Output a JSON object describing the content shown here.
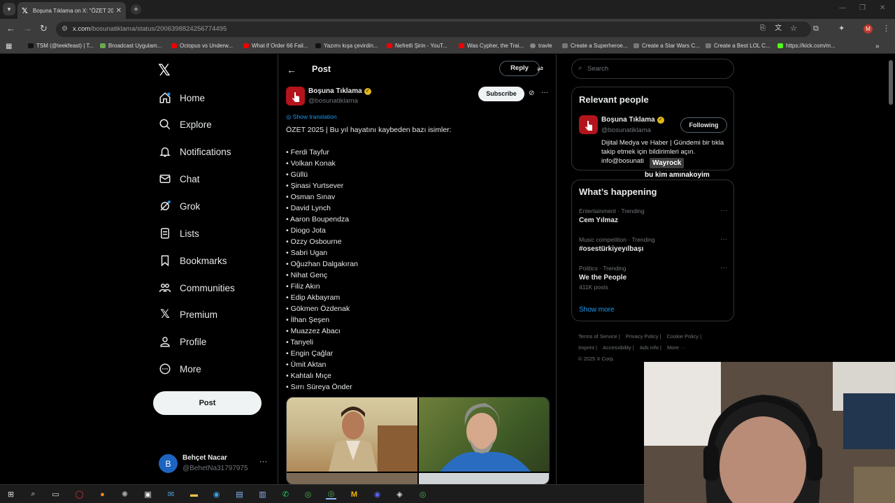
{
  "browser": {
    "tab_title": "Boşuna Tıklama on X: \"ÖZET 20…",
    "url_host": "x.com",
    "url_path": "/bosunatiklama/status/2006398824256774495",
    "profile_initial": "M",
    "bookmarks": [
      "TSM (@teekfeast) | T...",
      "Broadcast Uygulam...",
      "Octopus vs Underw...",
      "What if Order 66 Fail...",
      "Yazımı kışa çevirdin...",
      "Nefretli Şirin - YouT...",
      "Was Cypher, the Trai...",
      "travle",
      "Create a Superheroe...",
      "Create a Star Wars C...",
      "Create a Best LOL C...",
      "https://kick.com/m..."
    ]
  },
  "nav": {
    "items": [
      {
        "label": "Home",
        "icon": "home-icon"
      },
      {
        "label": "Explore",
        "icon": "search-icon"
      },
      {
        "label": "Notifications",
        "icon": "bell-icon"
      },
      {
        "label": "Chat",
        "icon": "mail-icon"
      },
      {
        "label": "Grok",
        "icon": "grok-icon"
      },
      {
        "label": "Lists",
        "icon": "list-icon"
      },
      {
        "label": "Bookmarks",
        "icon": "bookmark-icon"
      },
      {
        "label": "Communities",
        "icon": "people-icon"
      },
      {
        "label": "Premium",
        "icon": "x-icon"
      },
      {
        "label": "Profile",
        "icon": "person-icon"
      },
      {
        "label": "More",
        "icon": "more-circle-icon"
      }
    ],
    "post_button": "Post",
    "account": {
      "initial": "B",
      "name": "Behçet Nacar",
      "handle": "@BehetNa31797975"
    }
  },
  "post": {
    "header_title": "Post",
    "reply_button": "Reply",
    "author_name": "Boşuna Tıklama",
    "author_handle": "@bosunatiklama",
    "subscribe_button": "Subscribe",
    "show_translation": "Show translation",
    "intro": "ÖZET 2025 | Bu yıl hayatını kaybeden bazı isimler:",
    "names": [
      "• Ferdi Tayfur",
      "• Volkan Konak",
      "• Güllü",
      "• Şinasi Yurtsever",
      "• Osman Sınav",
      "• David Lynch",
      "• Aaron Boupendza",
      "• Diogo Jota",
      "• Ozzy Osbourne",
      "• Sabri Ugan",
      "• Oğuzhan Dalgakıran",
      "• Nihat Genç",
      "• Filiz Akın",
      "• Edip Akbayram",
      "• Gökmen Özdenak",
      "• İlhan Şeşen",
      "• Muazzez Abacı",
      "• Tanyeli",
      "• Engin Çağlar",
      "• Ümit Aktan",
      "• Kahtalı Mıçe",
      "• Sırrı Süreya Önder"
    ]
  },
  "sidebar": {
    "search_placeholder": "Search",
    "relevant_title": "Relevant people",
    "rel_name": "Boşuna Tıklama",
    "rel_handle": "@bosunatiklama",
    "follow_button": "Following",
    "rel_bio": "Dijital Medya ve Haber | Gündemi bir tıkla takip etmek için bildirimleri açın. info@bosunati",
    "happening_title": "What’s happening",
    "trends": [
      {
        "category": "Entertainment · Trending",
        "name": "Cem Yılmaz",
        "count": ""
      },
      {
        "category": "Music competition · Trending",
        "name": "#osestürkiyeyılbaşı",
        "count": ""
      },
      {
        "category": "Politics · Trending",
        "name": "We the People",
        "count": "411K posts"
      }
    ],
    "show_more": "Show more",
    "footer": [
      "Terms of Service |",
      "Privacy Policy |",
      "Cookie Policy |",
      "Imprint |",
      "Accessibility |",
      "Ads info |",
      "More ···",
      "© 2025 X Corp."
    ]
  },
  "overlay": {
    "tooltip": "Wayrock",
    "chat_text": "bu kim amınakoyim"
  },
  "colors": {
    "accent": "#1d9bf0",
    "verified": "#e2b719",
    "brand_red": "#b3141b"
  }
}
